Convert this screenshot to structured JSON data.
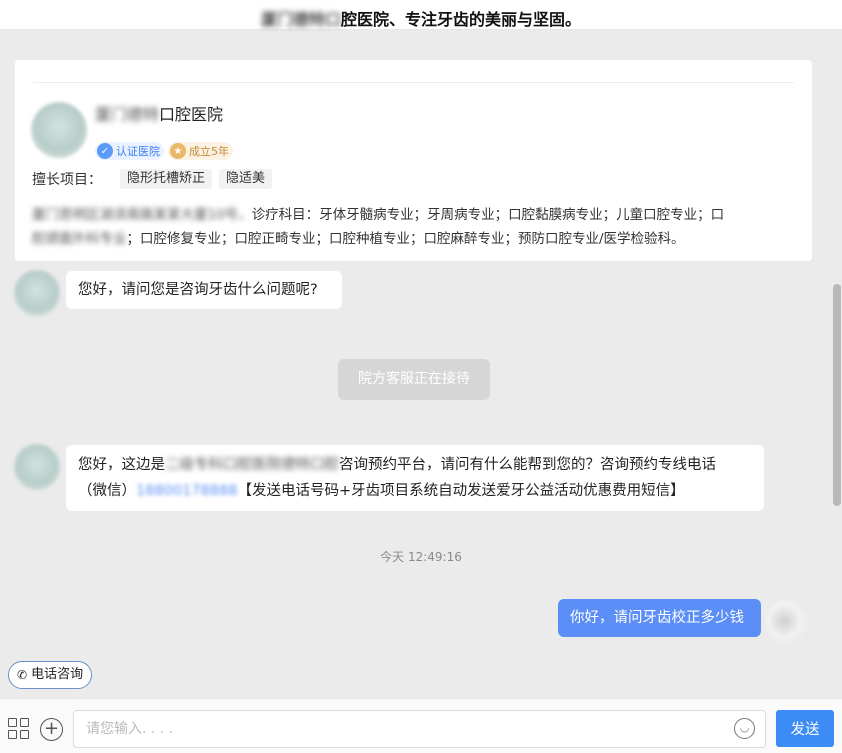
{
  "header": {
    "title_blurred": "厦门德特口",
    "title": "腔医院、专注牙齿的美丽与坚固。"
  },
  "clinic_card": {
    "name_blurred": "厦门德特",
    "name": "口腔医院",
    "badges": [
      {
        "icon": "check-shield-icon",
        "label": "认证医院"
      },
      {
        "icon": "star-icon",
        "label": "成立5年"
      }
    ],
    "skills_label": "擅长项目：",
    "skills": [
      "隐形托槽矫正",
      "隐适美"
    ],
    "address_blurred": "厦门思明区湖滨南路某某大厦10号，",
    "address_text": "诊疗科目：牙体牙髓病专业；牙周病专业；口腔黏膜病专业；儿童口腔专业；口",
    "address_blurred_2": "腔颌面外科专业",
    "address_text_2": "；口腔修复专业；口腔正畸专业；口腔种植专业；口腔麻醉专业；预防口腔专业/医学检验科。"
  },
  "messages": {
    "m1": "您好，请问您是咨询牙齿什么问题呢?",
    "notice": "院方客服正在接待",
    "m2_part1": "您好，这边是",
    "m2_blurred": "二级专科口腔医院德特口腔",
    "m2_part2": "咨询预约平台，请问有什么能帮到您的？咨询预约专线电话",
    "m2_part3": "（微信）",
    "m2_phone_blurred": "18800178888",
    "m2_part4": "【发送电话号码+牙齿项目系统自动发送爱牙公益活动优惠费用短信】",
    "timestamp": "今天 12:49:16",
    "user_message": "你好，请问牙齿校正多少钱"
  },
  "phone_consult_label": "电话咨询",
  "input": {
    "placeholder": "请您输入. . . ."
  },
  "send_label": "发送",
  "colors": {
    "accent": "#3d8cf5",
    "user_bubble": "#5b8ef6",
    "background": "#ebebeb"
  }
}
